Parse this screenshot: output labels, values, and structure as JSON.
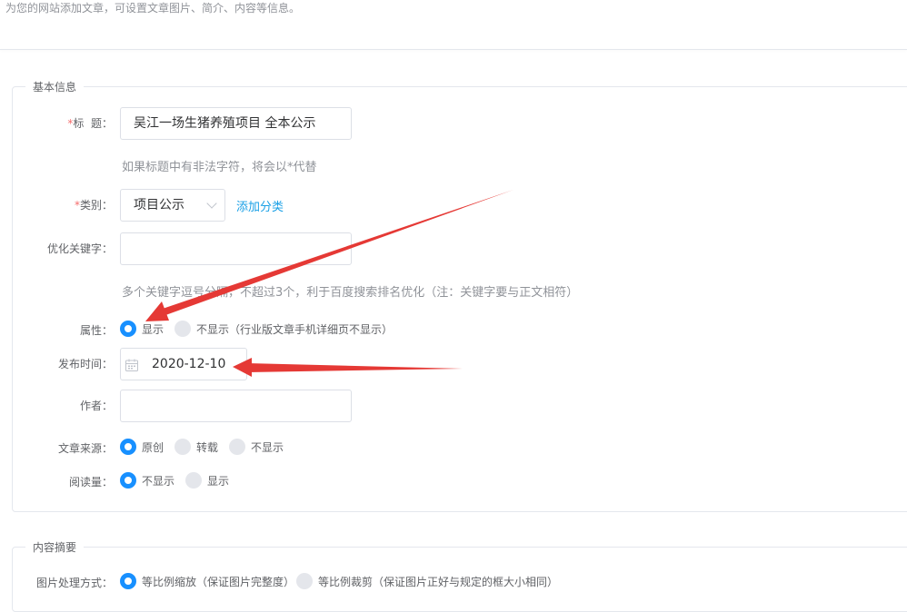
{
  "page": {
    "description": "为您的网站添加文章，可设置文章图片、简介、内容等信息。"
  },
  "basic": {
    "legend": "基本信息",
    "title": {
      "required_mark": "*",
      "label": "标  题：",
      "value": "吴江一场生猪养殖项目 全本公示",
      "hint": "如果标题中有非法字符，将会以*代替"
    },
    "category": {
      "required_mark": "*",
      "label": "类别：",
      "value": "项目公示",
      "add_link": "添加分类"
    },
    "keywords": {
      "label": "优化关键字：",
      "value": "",
      "hint": "多个关键字逗号分隔，不超过3个，利于百度搜索排名优化（注：关键字要与正文相符）"
    },
    "attribute": {
      "label": "属性：",
      "options": [
        "显示",
        "不显示（行业版文章手机详细页不显示）"
      ],
      "selected": 0
    },
    "publish_time": {
      "label": "发布时间：",
      "value": "2020-12-10"
    },
    "author": {
      "label": "作者：",
      "value": ""
    },
    "source": {
      "label": "文章来源：",
      "options": [
        "原创",
        "转载",
        "不显示"
      ],
      "selected": 0
    },
    "views": {
      "label": "阅读量：",
      "options": [
        "不显示",
        "显示"
      ],
      "selected": 0
    }
  },
  "summary": {
    "legend": "内容摘要",
    "image_mode": {
      "label": "图片处理方式：",
      "options": [
        "等比例缩放（保证图片完整度）",
        "等比例裁剪（保证图片正好与规定的框大小相同）"
      ],
      "selected": 0
    }
  },
  "colors": {
    "accent": "#1890ff",
    "link": "#1aa0e6",
    "required": "#f56c6c",
    "annotation_arrow": "#e53935"
  },
  "icons": [
    "calendar-icon",
    "chevron-down-icon",
    "red-arrow-annotation"
  ]
}
